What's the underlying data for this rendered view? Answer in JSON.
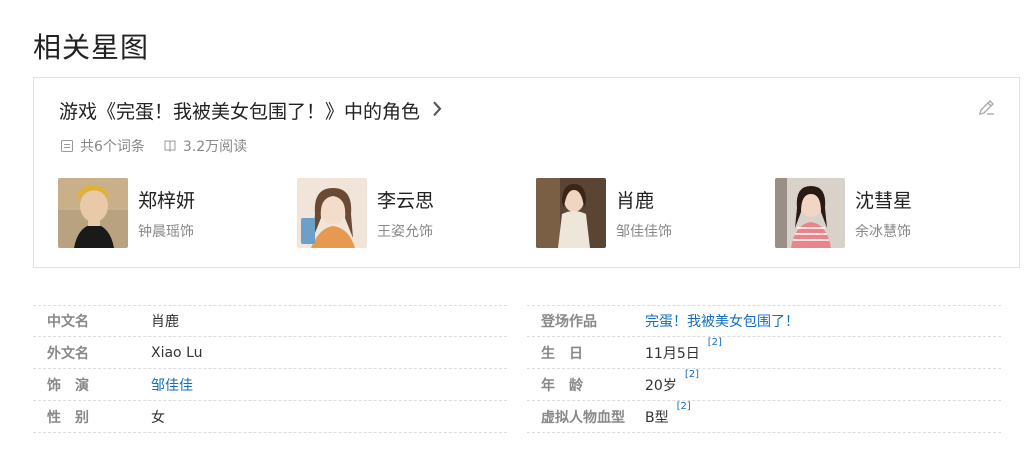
{
  "section_title": "相关星图",
  "card": {
    "heading": "游戏《完蛋！我被美女包围了！》中的角色",
    "entries": "共6个词条",
    "reads": "3.2万阅读",
    "characters": [
      {
        "name": "郑梓妍",
        "actor": "钟晨瑶饰"
      },
      {
        "name": "李云思",
        "actor": "王姿允饰"
      },
      {
        "name": "肖鹿",
        "actor": "邹佳佳饰"
      },
      {
        "name": "沈彗星",
        "actor": "余冰慧饰"
      }
    ]
  },
  "info": {
    "left": [
      {
        "label": "中文名",
        "value": "肖鹿"
      },
      {
        "label": "外文名",
        "value": "Xiao Lu"
      },
      {
        "label": "饰　演",
        "value": "邹佳佳"
      },
      {
        "label": "性　别",
        "value": "女"
      }
    ],
    "right": [
      {
        "label": "登场作品",
        "value": "完蛋！我被美女包围了！"
      },
      {
        "label": "生　日",
        "value": "11月5日",
        "ref": "[2]"
      },
      {
        "label": "年　龄",
        "value": "20岁",
        "ref": "[2]"
      },
      {
        "label": "虚拟人物血型",
        "value": "B型",
        "ref": "[2]"
      }
    ]
  },
  "colors": {
    "link": "#136ec2",
    "label": "#888888",
    "border": "#e1e1e1"
  },
  "icons": [
    "chevron-right-icon",
    "pencil-edit-icon",
    "list-icon",
    "book-icon"
  ]
}
